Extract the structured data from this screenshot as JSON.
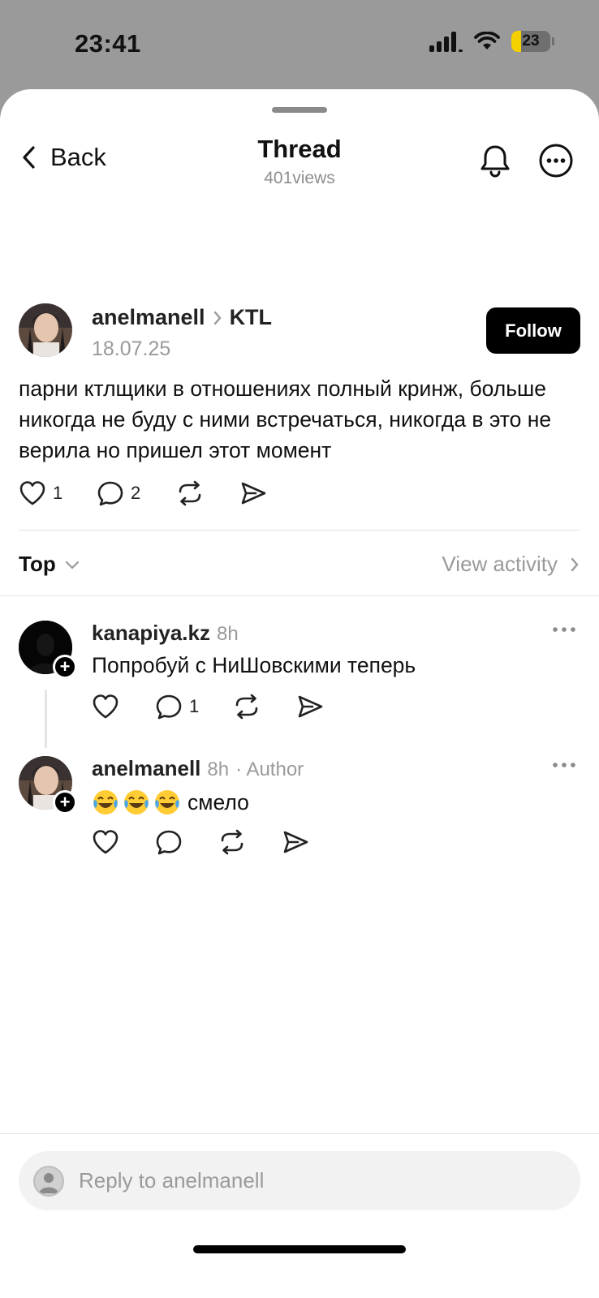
{
  "status_bar": {
    "time": "23:41",
    "battery": "23",
    "icons": [
      "cellular-signal-icon",
      "wifi-icon",
      "battery-icon"
    ]
  },
  "nav": {
    "back_label": "Back",
    "title": "Thread",
    "subtitle": "401views",
    "icons": [
      "chevron-left-icon",
      "bell-icon",
      "more-circle-icon"
    ]
  },
  "post": {
    "username": "anelmanell",
    "community": "KTL",
    "date": "18.07.25",
    "follow_label": "Follow",
    "text": "парни ктлщики в отношениях полный кринж, больше никогда не буду с ними встречаться, никогда в это не верила но пришел этот момент",
    "likes": "1",
    "replies": "2",
    "icons": [
      "heart-icon",
      "comment-icon",
      "repost-icon",
      "share-icon"
    ]
  },
  "sort": {
    "label": "Top",
    "view_activity": "View activity"
  },
  "replies": [
    {
      "username": "kanapiya.kz",
      "time": "8h",
      "author_tag": "",
      "text": "Попробуй с НиШовскими теперь",
      "replies": "1"
    },
    {
      "username": "anelmanell",
      "time": "8h",
      "author_tag": "· Author",
      "emoji": "face-with-tears-of-joy-emoji ×3",
      "text": "смело",
      "replies": ""
    }
  ],
  "composer": {
    "placeholder": "Reply to anelmanell"
  },
  "colors": {
    "background_dim": "#9a9a9a",
    "sheet": "#ffffff",
    "secondary_text": "#9a9a9a",
    "follow_button": "#000000",
    "battery_fill": "#f5d000"
  }
}
